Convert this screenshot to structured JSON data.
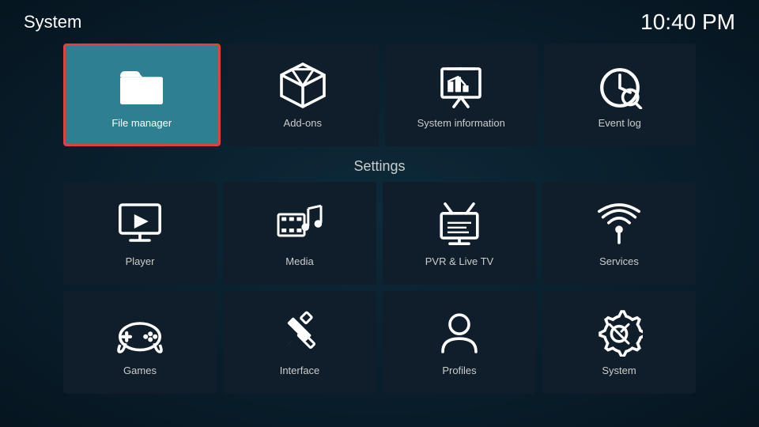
{
  "header": {
    "title": "System",
    "time": "10:40 PM"
  },
  "top_tiles": [
    {
      "id": "file-manager",
      "label": "File manager",
      "selected": true
    },
    {
      "id": "add-ons",
      "label": "Add-ons",
      "selected": false
    },
    {
      "id": "system-information",
      "label": "System information",
      "selected": false
    },
    {
      "id": "event-log",
      "label": "Event log",
      "selected": false
    }
  ],
  "settings_label": "Settings",
  "settings_rows": [
    [
      {
        "id": "player",
        "label": "Player"
      },
      {
        "id": "media",
        "label": "Media"
      },
      {
        "id": "pvr-live-tv",
        "label": "PVR & Live TV"
      },
      {
        "id": "services",
        "label": "Services"
      }
    ],
    [
      {
        "id": "games",
        "label": "Games"
      },
      {
        "id": "interface",
        "label": "Interface"
      },
      {
        "id": "profiles",
        "label": "Profiles"
      },
      {
        "id": "system-settings",
        "label": "System"
      }
    ]
  ]
}
